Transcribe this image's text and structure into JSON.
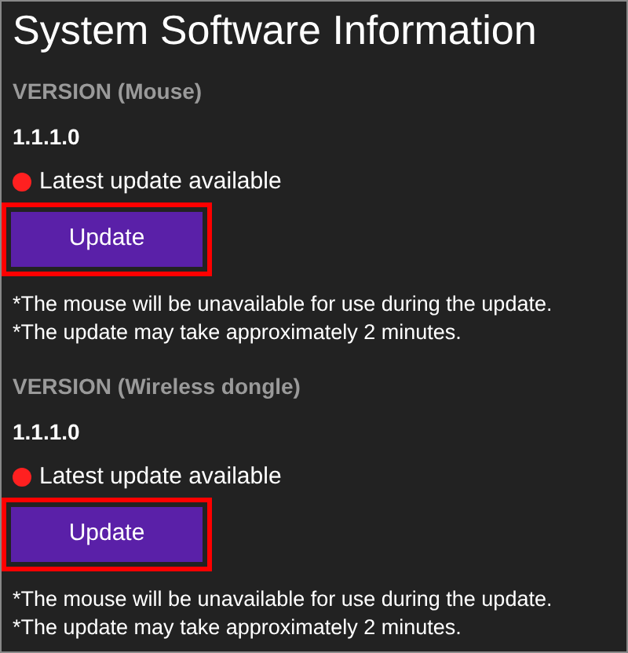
{
  "title": "System Software Information",
  "sections": [
    {
      "label": "VERSION (Mouse)",
      "version": "1.1.1.0",
      "status": {
        "text": "Latest update available",
        "color": "#ff2020"
      },
      "button": {
        "label": "Update",
        "highlighted": true
      },
      "notes": [
        "*The mouse will be unavailable for use during the update.",
        "*The update may take approximately 2 minutes."
      ]
    },
    {
      "label": "VERSION (Wireless dongle)",
      "version": "1.1.1.0",
      "status": {
        "text": "Latest update available",
        "color": "#ff2020"
      },
      "button": {
        "label": "Update",
        "highlighted": true
      },
      "notes": [
        "*The mouse will be unavailable for use during the update.",
        "*The update may take approximately 2 minutes."
      ]
    }
  ]
}
